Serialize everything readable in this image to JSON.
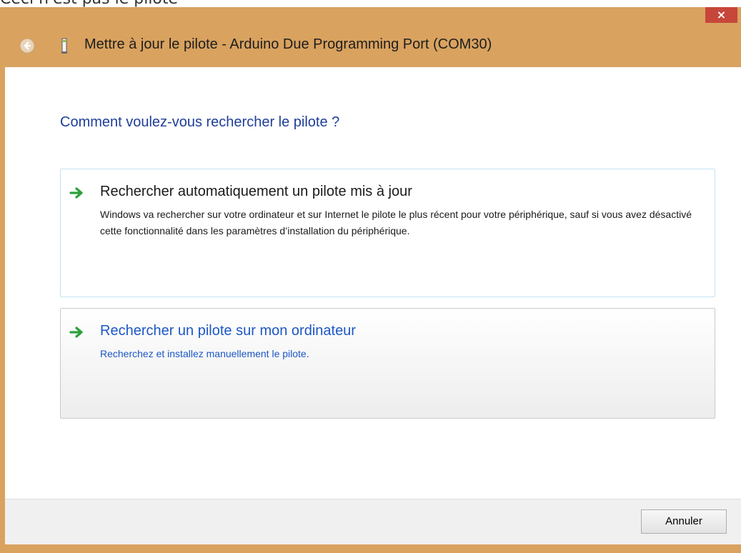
{
  "clipped_text": "Ceci n'est pas le pilote",
  "window": {
    "title": "Mettre à jour le pilote - Arduino Due Programming Port (COM30)",
    "close_label": "×",
    "frame_color": "#d9a25f",
    "close_color": "#c7463a"
  },
  "question": "Comment voulez-vous rechercher le pilote ?",
  "options": [
    {
      "title": "Rechercher automatiquement un pilote mis à jour",
      "description": "Windows va rechercher sur votre ordinateur et sur Internet le pilote le plus récent pour votre périphérique, sauf si vous avez désactivé cette fonctionnalité dans les paramètres d’installation du périphérique.",
      "icon": "green-arrow-icon"
    },
    {
      "title": "Rechercher un pilote sur mon ordinateur",
      "description": "Recherchez et installez manuellement le pilote.",
      "icon": "green-arrow-icon"
    }
  ],
  "footer": {
    "cancel_label": "Annuler"
  }
}
